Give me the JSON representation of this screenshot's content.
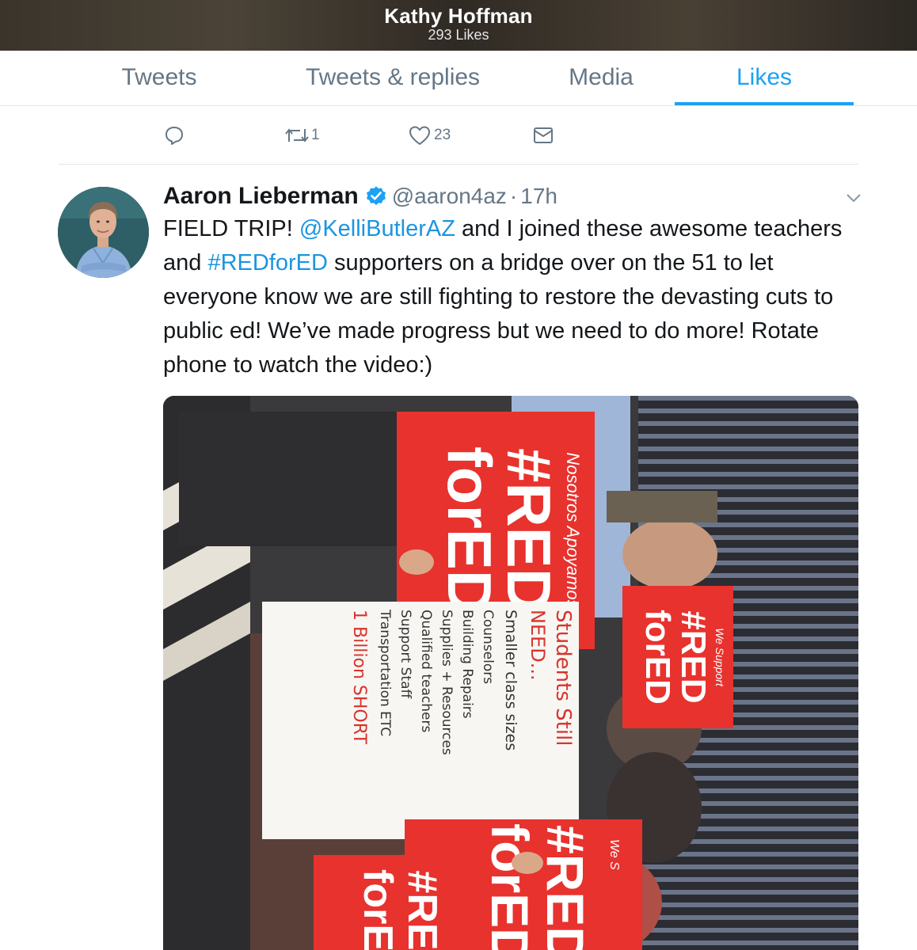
{
  "header": {
    "profile_name": "Kathy Hoffman",
    "likes_count": "293 Likes"
  },
  "tabs": [
    {
      "label": "Tweets",
      "active": false
    },
    {
      "label": "Tweets & replies",
      "active": false
    },
    {
      "label": "Media",
      "active": false
    },
    {
      "label": "Likes",
      "active": true
    }
  ],
  "previous_tweet_actions": {
    "reply_icon": "reply-icon",
    "retweet_icon": "retweet-icon",
    "retweet_count": "1",
    "like_icon": "heart-icon",
    "like_count": "23",
    "dm_icon": "envelope-icon"
  },
  "tweet": {
    "author_name": "Aaron Lieberman",
    "verified": true,
    "handle": "@aaron4az",
    "separator": "·",
    "time": "17h",
    "text_parts": {
      "p1": "FIELD TRIP! ",
      "mention": "@KelliButlerAZ",
      "p2": " and I joined these awesome teachers and ",
      "hashtag": "#REDforED",
      "p3": " supporters on a bridge over on the 51 to let everyone know we are still fighting to restore the devasting cuts to public ed!  We’ve made progress but we need to do more! Rotate phone to watch the video:)"
    },
    "media": {
      "sign_1_small": "Nosotros Apoyamos",
      "sign_1_main": "#RED",
      "sign_1_main2": "forED",
      "sign_2_small": "We Support",
      "sign_2_main": "#RED",
      "sign_2_main2": "forED",
      "poster_lines": [
        "Students Still",
        "NEED...",
        "Smaller class sizes",
        "Counselors",
        "Building Repairs",
        "Supplies + Resources",
        "Qualified teachers",
        "Support Staff",
        "Transportation  ETC",
        "1 Billion SHORT"
      ],
      "sign_3_main": "#RED",
      "sign_3_main2": "forED",
      "sign_3_small": "We S",
      "sign_4_main": "#RE",
      "sign_4_main2": "forE"
    }
  },
  "colors": {
    "accent": "#1da1f2",
    "link": "#1b95e0",
    "muted": "#657786",
    "sign_red": "#e8322e"
  }
}
